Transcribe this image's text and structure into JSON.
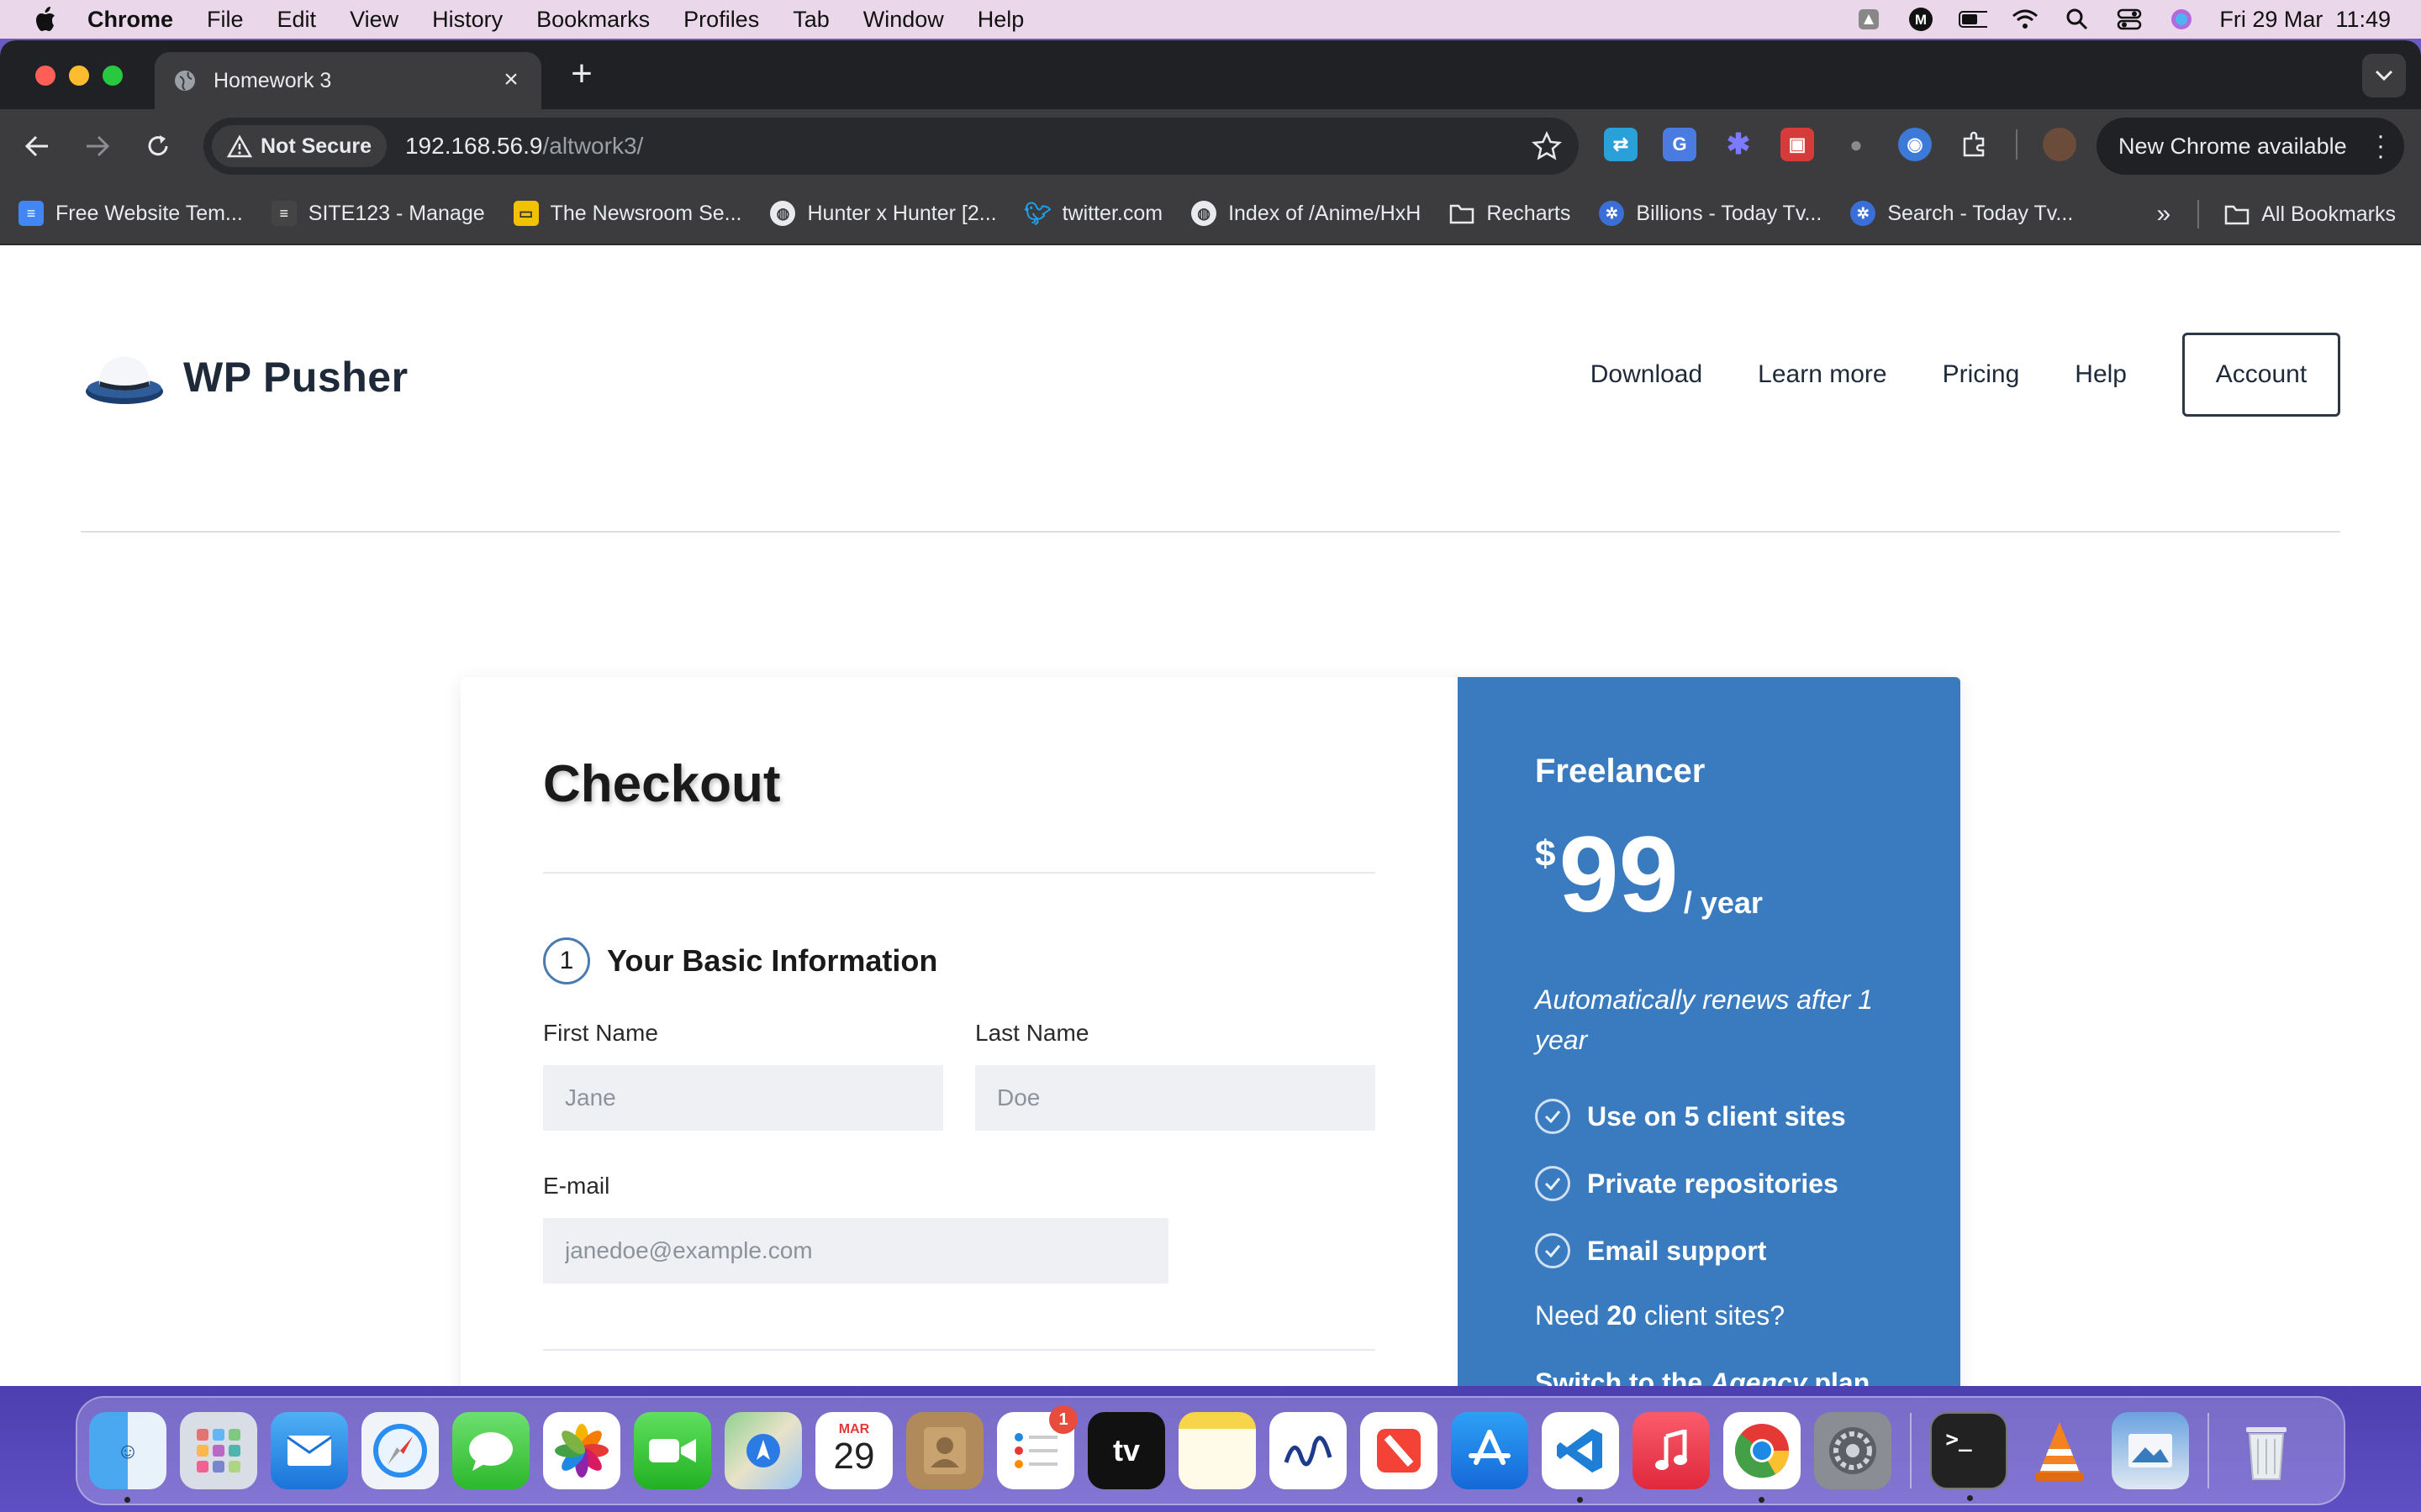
{
  "menubar": {
    "app": "Chrome",
    "items": [
      "File",
      "Edit",
      "View",
      "History",
      "Bookmarks",
      "Profiles",
      "Tab",
      "Window",
      "Help"
    ],
    "clock": "Fri 29 Mar  11:49"
  },
  "browser": {
    "tab_title": "Homework 3",
    "security_label": "Not Secure",
    "url_host": "192.168.56.9",
    "url_path": "/altwork3/",
    "update_label": "New Chrome available",
    "bookmarks": [
      {
        "label": "Free Website Tem...",
        "icon": "doc-icon",
        "color": "#4285f4"
      },
      {
        "label": "SITE123 - Manage",
        "icon": "site-icon",
        "color": "#444444"
      },
      {
        "label": "The Newsroom Se...",
        "icon": "tv-icon",
        "color": "#f2c200"
      },
      {
        "label": "Hunter x Hunter [2...",
        "icon": "globe-icon",
        "color": "#5f6368"
      },
      {
        "label": "twitter.com",
        "icon": "twitter-icon",
        "color": "#1da1f2"
      },
      {
        "label": "Index of /Anime/HxH",
        "icon": "globe-icon",
        "color": "#5f6368"
      },
      {
        "label": "Recharts",
        "icon": "folder-icon",
        "color": "#3c3c3f"
      },
      {
        "label": "Billions - Today Tv...",
        "icon": "film-icon",
        "color": "#3a6fd8"
      },
      {
        "label": "Search - Today Tv...",
        "icon": "film-icon",
        "color": "#3a6fd8"
      }
    ],
    "all_bookmarks": "All Bookmarks"
  },
  "site": {
    "brand": "WP Pusher",
    "nav": [
      "Download",
      "Learn more",
      "Pricing",
      "Help"
    ],
    "account": "Account"
  },
  "checkout": {
    "title": "Checkout",
    "step_number": "1",
    "step_title": "Your Basic Information",
    "first_name_label": "First Name",
    "first_name_placeholder": "Jane",
    "last_name_label": "Last Name",
    "last_name_placeholder": "Doe",
    "email_label": "E-mail",
    "email_placeholder": "janedoe@example.com"
  },
  "plan": {
    "name": "Freelancer",
    "currency": "$",
    "price": "99",
    "period": "/ year",
    "renews": "Automatically renews after 1 year",
    "features": [
      "Use on 5 client sites",
      "Private repositories",
      "Email support"
    ],
    "need_prefix": "Need ",
    "need_count": "20",
    "need_suffix": " client sites?",
    "switch_prefix": "Switch to the ",
    "switch_plan": "Agency",
    "switch_suffix": " plan",
    "switch_end": "."
  },
  "dock": {
    "calendar_month": "MAR",
    "calendar_day": "29",
    "reminders_badge": "1",
    "appletv_label": "tv"
  },
  "colors": {
    "plan_bg": "#3a7bbf",
    "input_bg": "#eef0f3",
    "chrome_dark": "#3c3c3f"
  }
}
